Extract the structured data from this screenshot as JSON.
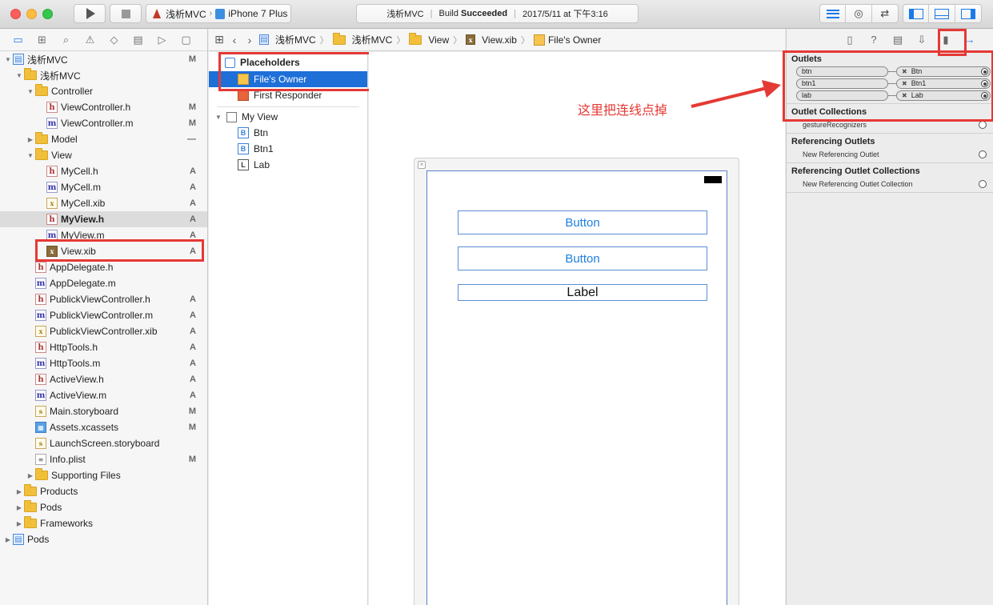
{
  "toolbar": {
    "scheme_app": "浅析MVC",
    "scheme_device": "iPhone 7 Plus",
    "status_project": "浅析MVC",
    "status_build_prefix": "Build",
    "status_build_result": "Succeeded",
    "status_time": "2017/5/11 at 下午3:16"
  },
  "navigator": {
    "rows": [
      {
        "label": "浅析MVC",
        "badge": "M"
      },
      {
        "label": "浅析MVC",
        "badge": ""
      },
      {
        "label": "Controller",
        "badge": ""
      },
      {
        "label": "ViewController.h",
        "badge": "M"
      },
      {
        "label": "ViewController.m",
        "badge": "M"
      },
      {
        "label": "Model",
        "badge": "—"
      },
      {
        "label": "View",
        "badge": ""
      },
      {
        "label": "MyCell.h",
        "badge": "A"
      },
      {
        "label": "MyCell.m",
        "badge": "A"
      },
      {
        "label": "MyCell.xib",
        "badge": "A"
      },
      {
        "label": "MyView.h",
        "badge": "A"
      },
      {
        "label": "MyView.m",
        "badge": "A"
      },
      {
        "label": "View.xib",
        "badge": "A"
      },
      {
        "label": "AppDelegate.h",
        "badge": ""
      },
      {
        "label": "AppDelegate.m",
        "badge": ""
      },
      {
        "label": "PublickViewController.h",
        "badge": "A"
      },
      {
        "label": "PublickViewController.m",
        "badge": "A"
      },
      {
        "label": "PublickViewController.xib",
        "badge": "A"
      },
      {
        "label": "HttpTools.h",
        "badge": "A"
      },
      {
        "label": "HttpTools.m",
        "badge": "A"
      },
      {
        "label": "ActiveView.h",
        "badge": "A"
      },
      {
        "label": "ActiveView.m",
        "badge": "A"
      },
      {
        "label": "Main.storyboard",
        "badge": "M"
      },
      {
        "label": "Assets.xcassets",
        "badge": "M"
      },
      {
        "label": "LaunchScreen.storyboard",
        "badge": ""
      },
      {
        "label": "Info.plist",
        "badge": "M"
      },
      {
        "label": "Supporting Files",
        "badge": ""
      },
      {
        "label": "Products",
        "badge": ""
      },
      {
        "label": "Pods",
        "badge": ""
      },
      {
        "label": "Frameworks",
        "badge": ""
      },
      {
        "label": "Pods",
        "badge": ""
      }
    ]
  },
  "jumpbar": {
    "crumbs": [
      "浅析MVC",
      "浅析MVC",
      "View",
      "View.xib",
      "File's Owner"
    ]
  },
  "outline": {
    "placeholders": "Placeholders",
    "files_owner": "File's Owner",
    "first_responder": "First Responder",
    "my_view": "My View",
    "btn": "Btn",
    "btn1": "Btn1",
    "lab": "Lab",
    "btn_icon": "B",
    "lab_icon": "L"
  },
  "canvas": {
    "button1": "Button",
    "button2": "Button",
    "label": "Label"
  },
  "inspector": {
    "outlets_title": "Outlets",
    "outlets": [
      {
        "name": "btn",
        "target": "Btn"
      },
      {
        "name": "btn1",
        "target": "Btn1"
      },
      {
        "name": "lab",
        "target": "Lab"
      }
    ],
    "outlet_collections_title": "Outlet Collections",
    "gesture": "gestureRecognizers",
    "referencing_outlets_title": "Referencing Outlets",
    "new_ref_outlet": "New Referencing Outlet",
    "referencing_collections_title": "Referencing Outlet Collections",
    "new_ref_collection": "New Referencing Outlet Collection"
  },
  "annotation": {
    "text": "这里把连线点掉",
    "color": "#e53935"
  }
}
